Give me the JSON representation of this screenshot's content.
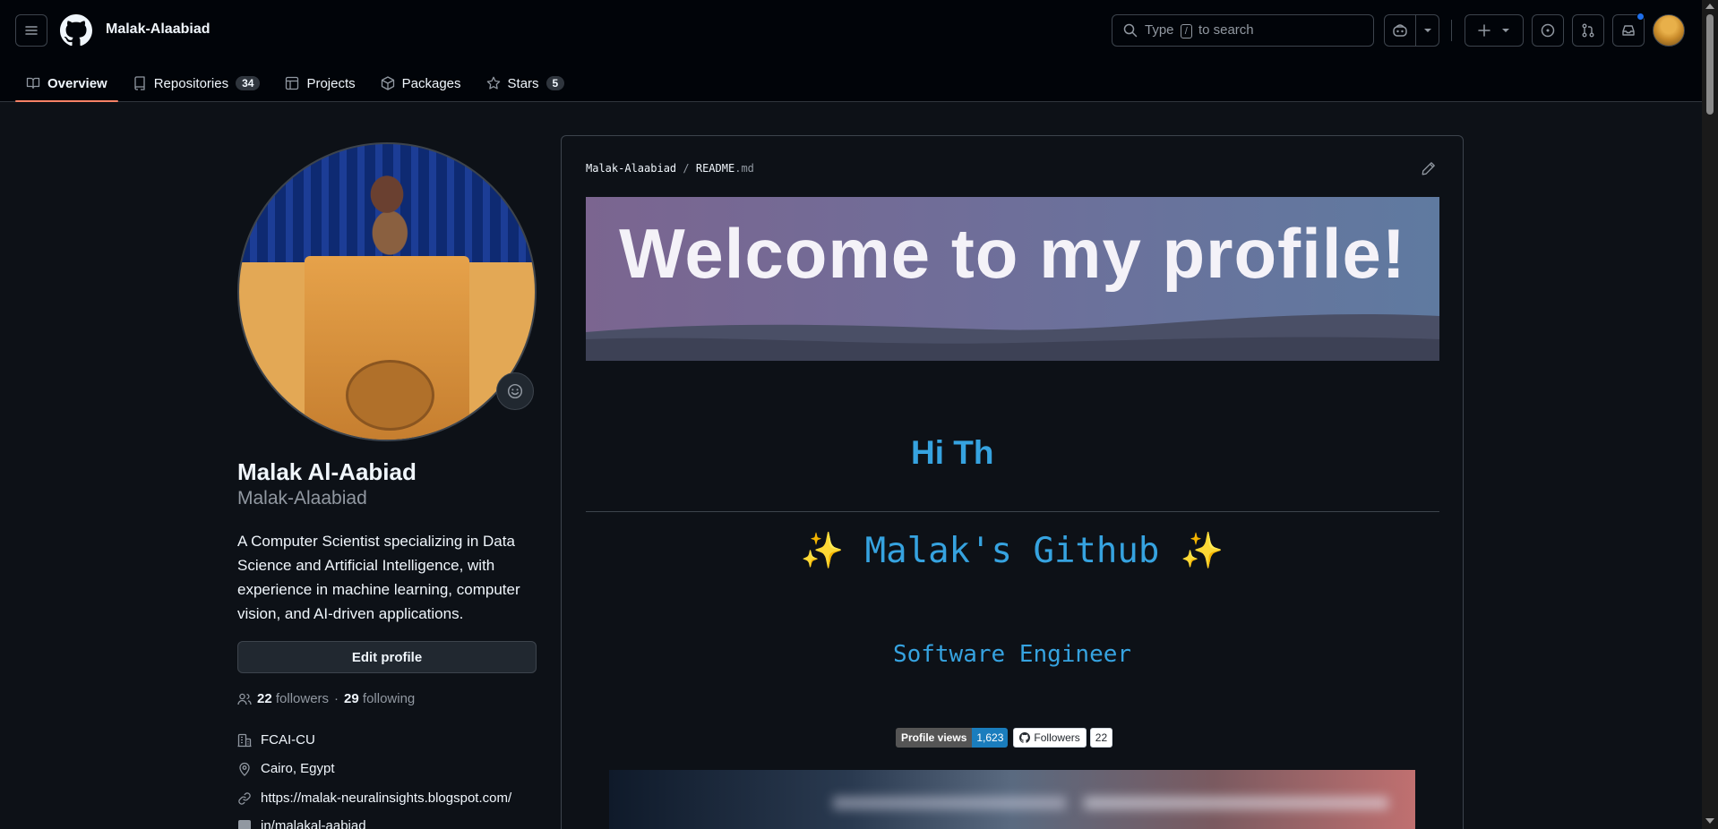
{
  "header": {
    "owner": "Malak-Alaabiad",
    "search_prefix": "Type",
    "search_key": "/",
    "search_suffix": "to search"
  },
  "tabs": [
    {
      "label": "Overview",
      "icon": "book-icon"
    },
    {
      "label": "Repositories",
      "count": "34",
      "icon": "repo-icon"
    },
    {
      "label": "Projects",
      "icon": "table-icon"
    },
    {
      "label": "Packages",
      "icon": "package-icon"
    },
    {
      "label": "Stars",
      "count": "5",
      "icon": "star-icon"
    }
  ],
  "profile": {
    "name": "Malak Al-Aabiad",
    "login": "Malak-Alaabiad",
    "bio": "A Computer Scientist specializing in Data Science and Artificial Intelligence, with experience in machine learning, computer vision, and AI-driven applications.",
    "edit_label": "Edit profile",
    "followers_count": "22",
    "followers_label": "followers",
    "following_count": "29",
    "following_label": "following",
    "dot": "·",
    "organization": "FCAI-CU",
    "location": "Cairo, Egypt",
    "website": "https://malak-neuralinsights.blogspot.com/",
    "linkedin": "in/malakal-aabiad"
  },
  "readme": {
    "crumb_owner": "Malak-Alaabiad",
    "crumb_sep": "/",
    "crumb_file": "README",
    "crumb_ext": ".md",
    "banner_title": "Welcome to my profile!",
    "hi_text": "Hi Th",
    "github_title": "✨ Malak's Github ✨",
    "role": "Software Engineer",
    "badge_views_label": "Profile views",
    "badge_views_value": "1,623",
    "badge_followers_label": "Followers",
    "badge_followers_value": "22"
  },
  "colors": {
    "accent": "#f78166",
    "link": "#36a3e0",
    "background": "#0d1117"
  }
}
